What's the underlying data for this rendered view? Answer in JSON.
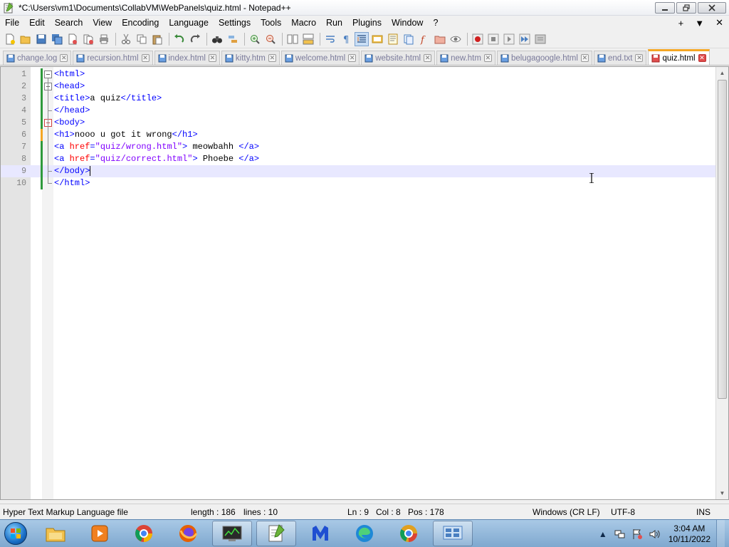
{
  "window": {
    "title": "*C:\\Users\\vm1\\Documents\\CollabVM\\WebPanels\\quiz.html - Notepad++"
  },
  "menu": {
    "items": [
      "File",
      "Edit",
      "Search",
      "View",
      "Encoding",
      "Language",
      "Settings",
      "Tools",
      "Macro",
      "Run",
      "Plugins",
      "Window",
      "?"
    ],
    "right_plus": "+",
    "right_down": "▼",
    "right_close": "✕"
  },
  "tabs": [
    {
      "label": "change.log",
      "active": false
    },
    {
      "label": "recursion.html",
      "active": false
    },
    {
      "label": "index.html",
      "active": false
    },
    {
      "label": "kitty.htm",
      "active": false
    },
    {
      "label": "welcome.html",
      "active": false
    },
    {
      "label": "website.html",
      "active": false
    },
    {
      "label": "new.htm",
      "active": false
    },
    {
      "label": "belugagoogle.html",
      "active": false
    },
    {
      "label": "end.txt",
      "active": false
    },
    {
      "label": "quiz.html",
      "active": true
    }
  ],
  "editor": {
    "line_numbers": [
      "1",
      "2",
      "3",
      "4",
      "5",
      "6",
      "7",
      "8",
      "9",
      "10"
    ],
    "current_line": 9,
    "lines": [
      [
        {
          "t": "tag",
          "v": "<html>"
        }
      ],
      [
        {
          "t": "tag",
          "v": "<head>"
        }
      ],
      [
        {
          "t": "tag",
          "v": "<title>"
        },
        {
          "t": "txt",
          "v": "a quiz"
        },
        {
          "t": "tag",
          "v": "</title>"
        }
      ],
      [
        {
          "t": "tag",
          "v": "</head>"
        }
      ],
      [
        {
          "t": "tag",
          "v": "<body>"
        }
      ],
      [
        {
          "t": "tag",
          "v": "<h1>"
        },
        {
          "t": "txt",
          "v": "nooo u got it wrong"
        },
        {
          "t": "tag",
          "v": "</h1>"
        }
      ],
      [
        {
          "t": "tag",
          "v": "<a "
        },
        {
          "t": "attr",
          "v": "href"
        },
        {
          "t": "tag",
          "v": "="
        },
        {
          "t": "str",
          "v": "\"quiz/wrong.html\""
        },
        {
          "t": "tag",
          "v": ">"
        },
        {
          "t": "txt",
          "v": " meowbahh "
        },
        {
          "t": "tag",
          "v": "</a>"
        }
      ],
      [
        {
          "t": "tag",
          "v": "<a "
        },
        {
          "t": "attr",
          "v": "href"
        },
        {
          "t": "tag",
          "v": "="
        },
        {
          "t": "str",
          "v": "\"quiz/correct.html\""
        },
        {
          "t": "tag",
          "v": ">"
        },
        {
          "t": "txt",
          "v": " Phoebe "
        },
        {
          "t": "tag",
          "v": "</a>"
        }
      ],
      [
        {
          "t": "tag",
          "v": "</body>"
        }
      ],
      [
        {
          "t": "tag",
          "v": "</html>"
        }
      ]
    ]
  },
  "status": {
    "file_type": "Hyper Text Markup Language file",
    "length": "length : 186",
    "lines": "lines : 10",
    "ln": "Ln : 9",
    "col": "Col : 8",
    "pos": "Pos : 178",
    "eol": "Windows (CR LF)",
    "encoding": "UTF-8",
    "mode": "INS"
  },
  "taskbar": {
    "apps": [
      "file-explorer",
      "media-player",
      "chrome",
      "firefox",
      "task-manager",
      "notepad-plus-plus",
      "malwarebytes",
      "edge",
      "chrome-canary",
      "control-panel"
    ],
    "time": "3:04 AM",
    "date": "10/11/2022"
  },
  "colors": {
    "tag": "#0000ff",
    "attr": "#ff0000",
    "string": "#8000ff",
    "active_tab_accent": "#f5a623",
    "change_bar": "#2f9a3c",
    "current_line": "#e8e8ff"
  }
}
